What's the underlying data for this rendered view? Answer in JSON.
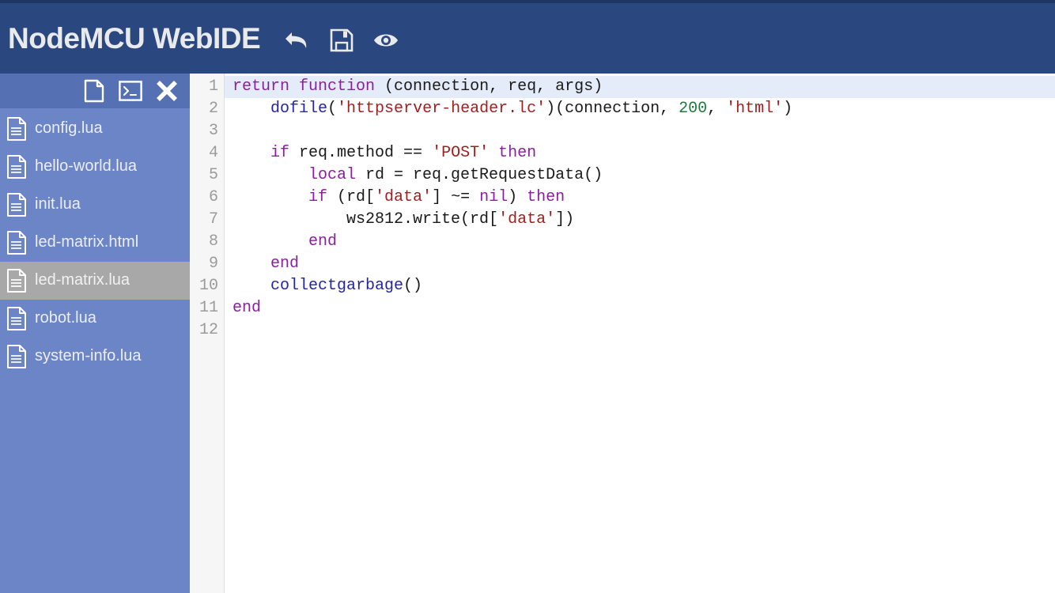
{
  "header": {
    "title": "NodeMCU WebIDE",
    "tools": [
      {
        "name": "undo-icon",
        "label": "Undo"
      },
      {
        "name": "save-icon",
        "label": "Save"
      },
      {
        "name": "preview-icon",
        "label": "Preview"
      }
    ]
  },
  "sidebar": {
    "toolbar": [
      {
        "name": "new-file-icon",
        "label": "New file"
      },
      {
        "name": "terminal-icon",
        "label": "Terminal"
      },
      {
        "name": "close-icon",
        "label": "Close"
      }
    ],
    "files": [
      {
        "label": "config.lua",
        "selected": false
      },
      {
        "label": "hello-world.lua",
        "selected": false
      },
      {
        "label": "init.lua",
        "selected": false
      },
      {
        "label": "led-matrix.html",
        "selected": false
      },
      {
        "label": "led-matrix.lua",
        "selected": true
      },
      {
        "label": "robot.lua",
        "selected": false
      },
      {
        "label": "system-info.lua",
        "selected": false
      }
    ]
  },
  "editor": {
    "active_line": 1,
    "line_numbers": [
      "1",
      "2",
      "3",
      "4",
      "5",
      "6",
      "7",
      "8",
      "9",
      "10",
      "11",
      "12"
    ],
    "lines": [
      {
        "n": "1",
        "tokens": [
          {
            "t": "return",
            "c": "kw"
          },
          {
            "t": " ",
            "c": "plain"
          },
          {
            "t": "function",
            "c": "kw"
          },
          {
            "t": " (connection, req, args)",
            "c": "plain"
          }
        ]
      },
      {
        "n": "2",
        "tokens": [
          {
            "t": "    ",
            "c": "plain"
          },
          {
            "t": "dofile",
            "c": "fn"
          },
          {
            "t": "(",
            "c": "plain"
          },
          {
            "t": "'httpserver-header.lc'",
            "c": "str"
          },
          {
            "t": ")(connection, ",
            "c": "plain"
          },
          {
            "t": "200",
            "c": "num"
          },
          {
            "t": ", ",
            "c": "plain"
          },
          {
            "t": "'html'",
            "c": "str"
          },
          {
            "t": ")",
            "c": "plain"
          }
        ]
      },
      {
        "n": "3",
        "tokens": [
          {
            "t": "",
            "c": "plain"
          }
        ]
      },
      {
        "n": "4",
        "tokens": [
          {
            "t": "    ",
            "c": "plain"
          },
          {
            "t": "if",
            "c": "kw"
          },
          {
            "t": " req.method == ",
            "c": "plain"
          },
          {
            "t": "'POST'",
            "c": "str"
          },
          {
            "t": " ",
            "c": "plain"
          },
          {
            "t": "then",
            "c": "kw"
          }
        ]
      },
      {
        "n": "5",
        "tokens": [
          {
            "t": "        ",
            "c": "plain"
          },
          {
            "t": "local",
            "c": "kw"
          },
          {
            "t": " rd = req.getRequestData()",
            "c": "plain"
          }
        ]
      },
      {
        "n": "6",
        "tokens": [
          {
            "t": "        ",
            "c": "plain"
          },
          {
            "t": "if",
            "c": "kw"
          },
          {
            "t": " (rd[",
            "c": "plain"
          },
          {
            "t": "'data'",
            "c": "str"
          },
          {
            "t": "] ~= ",
            "c": "plain"
          },
          {
            "t": "nil",
            "c": "kw"
          },
          {
            "t": ") ",
            "c": "plain"
          },
          {
            "t": "then",
            "c": "kw"
          }
        ]
      },
      {
        "n": "7",
        "tokens": [
          {
            "t": "            ws2812.write(rd[",
            "c": "plain"
          },
          {
            "t": "'data'",
            "c": "str"
          },
          {
            "t": "])",
            "c": "plain"
          }
        ]
      },
      {
        "n": "8",
        "tokens": [
          {
            "t": "        ",
            "c": "plain"
          },
          {
            "t": "end",
            "c": "kw"
          }
        ]
      },
      {
        "n": "9",
        "tokens": [
          {
            "t": "    ",
            "c": "plain"
          },
          {
            "t": "end",
            "c": "kw"
          }
        ]
      },
      {
        "n": "10",
        "tokens": [
          {
            "t": "    ",
            "c": "plain"
          },
          {
            "t": "collectgarbage",
            "c": "fn"
          },
          {
            "t": "()",
            "c": "plain"
          }
        ]
      },
      {
        "n": "11",
        "tokens": [
          {
            "t": "end",
            "c": "kw"
          }
        ]
      },
      {
        "n": "12",
        "tokens": [
          {
            "t": "",
            "c": "plain"
          }
        ]
      }
    ]
  },
  "colors": {
    "header_bg": "#2b477f",
    "top_strip": "#1f3663",
    "sidebar_bg": "#6c85c6",
    "sidebar_toolbar_bg": "#5670b4",
    "selected_file_bg": "#a8a8a8",
    "gutter_bg": "#f6f6f6",
    "active_line_bg": "#e4ecf9",
    "keyword": "#8a1f9e",
    "function": "#26269c",
    "string": "#9e2020",
    "number": "#1f7a3d"
  }
}
